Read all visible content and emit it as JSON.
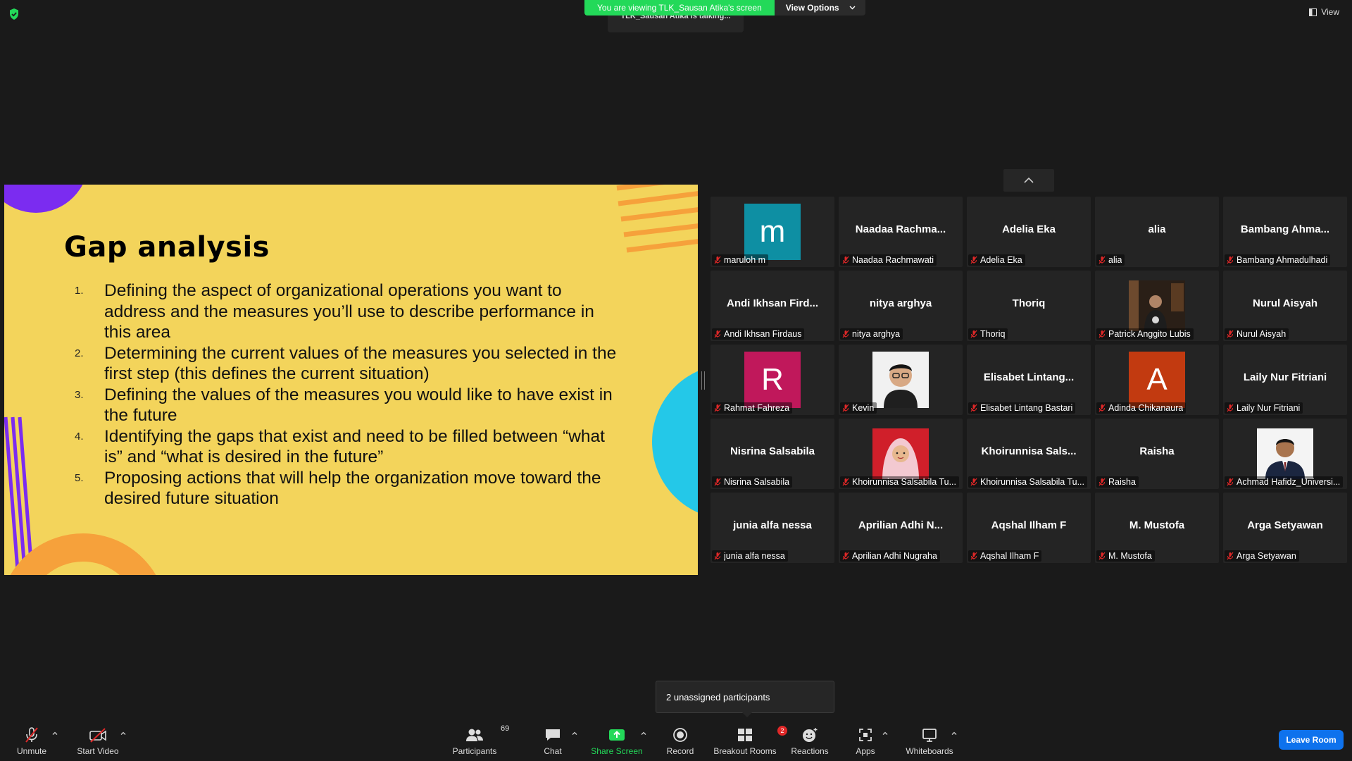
{
  "banner": {
    "viewing_text": "You are viewing TLK_Sausan Atika's screen",
    "view_options_label": "View Options",
    "talking_text": "TLK_Sausan Atika is talking...",
    "view_label": "View"
  },
  "slide": {
    "title": "Gap analysis",
    "items": [
      {
        "num": "1.",
        "text": "Defining the aspect of organizational operations you want to address and the measures you’ll use to describe performance in this area"
      },
      {
        "num": "2.",
        "text": "Determining the current values of the measures you selected in the first step (this defines the current situation)"
      },
      {
        "num": "3.",
        "text": "Defining the values of the measures you would like to have exist in the future"
      },
      {
        "num": "4.",
        "text": "Identifying the gaps that exist and need to be filled between “what is” and “what is desired in the future”"
      },
      {
        "num": "5.",
        "text": "Proposing actions that will help the organization move toward the desired future situation"
      }
    ]
  },
  "gallery": [
    {
      "big": "",
      "label": "maruloh m",
      "avatar": "m",
      "avatar_color": "#0e8fa3"
    },
    {
      "big": "Naadaa  Rachma...",
      "label": "Naadaa Rachmawati"
    },
    {
      "big": "Adelia Eka",
      "label": "Adelia Eka"
    },
    {
      "big": "alia",
      "label": "alia"
    },
    {
      "big": "Bambang  Ahma...",
      "label": "Bambang Ahmadulhadi"
    },
    {
      "big": "Andi  Ikhsan  Fird...",
      "label": "Andi Ikhsan Firdaus"
    },
    {
      "big": "nitya arghya",
      "label": "nitya arghya"
    },
    {
      "big": "Thoriq",
      "label": "Thoriq"
    },
    {
      "big": "",
      "label": "Patrick Anggito Lubis",
      "photo": "dark-room"
    },
    {
      "big": "Nurul Aisyah",
      "label": "Nurul Aisyah"
    },
    {
      "big": "",
      "label": "Rahmat Fahreza",
      "avatar": "R",
      "avatar_color": "#c0185b"
    },
    {
      "big": "",
      "label": "Kevin",
      "photo": "portrait-light"
    },
    {
      "big": "Elisabet  Lintang...",
      "label": "Elisabet Lintang Bastari"
    },
    {
      "big": "",
      "label": "Adinda Chikanaura",
      "avatar": "A",
      "avatar_color": "#c23a10"
    },
    {
      "big": "Laily Nur Fitriani",
      "label": "Laily Nur Fitriani"
    },
    {
      "big": "Nisrina Salsabila",
      "label": "Nisrina Salsabila"
    },
    {
      "big": "",
      "label": "Khoirunnisa Salsabila Tu...",
      "photo": "portrait-red"
    },
    {
      "big": "Khoirunnisa  Sals...",
      "label": "Khoirunnisa Salsabila Tu..."
    },
    {
      "big": "Raisha",
      "label": "Raisha"
    },
    {
      "big": "",
      "label": "Achmad Hafidz_Universi...",
      "photo": "portrait-white"
    },
    {
      "big": "junia alfa nessa",
      "label": "junia alfa nessa"
    },
    {
      "big": "Aprilian  Adhi  N...",
      "label": "Aprilian Adhi Nugraha"
    },
    {
      "big": "Aqshal Ilham F",
      "label": "Aqshal Ilham F"
    },
    {
      "big": "M. Mustofa",
      "label": "M. Mustofa"
    },
    {
      "big": "Arga Setyawan",
      "label": "Arga Setyawan"
    }
  ],
  "popup": {
    "text": "2 unassigned participants"
  },
  "toolbar": {
    "unmute": "Unmute",
    "start_video": "Start Video",
    "participants": "Participants",
    "participants_count": "69",
    "chat": "Chat",
    "share_screen": "Share Screen",
    "record": "Record",
    "breakout_rooms": "Breakout Rooms",
    "breakout_badge": "2",
    "reactions": "Reactions",
    "apps": "Apps",
    "whiteboards": "Whiteboards",
    "leave_room": "Leave Room"
  },
  "colors": {
    "share_green": "#23d959",
    "leave_blue": "#0e72ed",
    "muted_red": "#e02828",
    "slide_yellow": "#f3d45b"
  }
}
